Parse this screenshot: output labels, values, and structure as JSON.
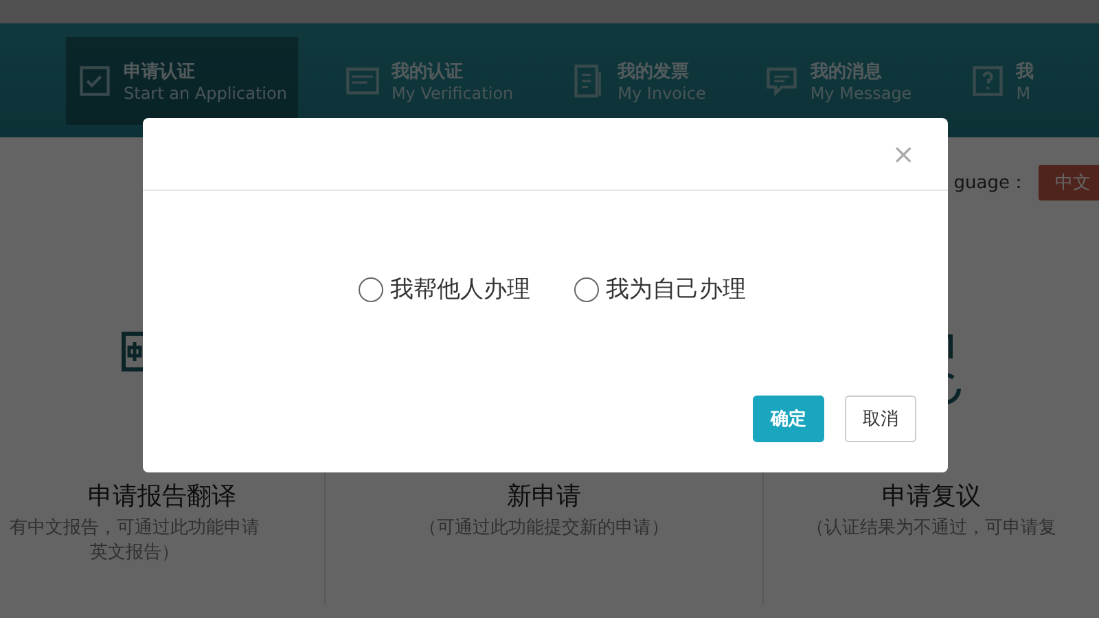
{
  "nav": {
    "items": [
      {
        "kind": "check",
        "title": "申请认证",
        "subtitle": "Start an Application",
        "selected": true
      },
      {
        "kind": "card",
        "title": "我的认证",
        "subtitle": "My Verification",
        "selected": false
      },
      {
        "kind": "invoice",
        "title": "我的发票",
        "subtitle": "My Invoice",
        "selected": false
      },
      {
        "kind": "message",
        "title": "我的消息",
        "subtitle": "My Message",
        "selected": false
      },
      {
        "kind": "help",
        "title": "我",
        "subtitle": "M",
        "selected": false
      }
    ]
  },
  "language": {
    "label": "guage：",
    "value": "中文"
  },
  "cards": [
    {
      "kind": "translate",
      "title": "申请报告翻译",
      "description": [
        "有中文报告，可通过此功能申请",
        "英文报告）"
      ]
    },
    {
      "kind": "new",
      "title": "新申请",
      "description": [
        "（可通过此功能提交新的申请）"
      ]
    },
    {
      "kind": "review",
      "title": "申请复议",
      "description": [
        "（认证结果为不通过，可申请复"
      ]
    }
  ],
  "dialog": {
    "close": "×",
    "options": [
      {
        "label": "我帮他人办理",
        "selected": false
      },
      {
        "label": "我为自己办理",
        "selected": false
      }
    ],
    "buttons": [
      {
        "label": "确定",
        "kind": "primary"
      },
      {
        "label": "取消",
        "kind": "default"
      }
    ]
  }
}
